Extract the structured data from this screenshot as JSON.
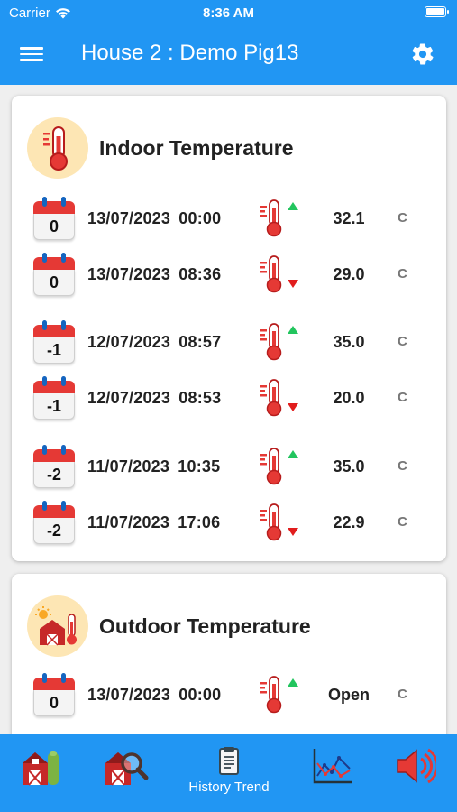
{
  "status_bar": {
    "carrier": "Carrier",
    "time": "8:36 AM"
  },
  "header": {
    "title": "House 2 : Demo Pig13"
  },
  "indoor": {
    "title": "Indoor Temperature",
    "rows": [
      {
        "day": "0",
        "datetime": "13/07/2023  00:00",
        "trend": "up",
        "value": "32.1",
        "unit": "C"
      },
      {
        "day": "0",
        "datetime": "13/07/2023  08:36",
        "trend": "down",
        "value": "29.0",
        "unit": "C"
      },
      {
        "day": "-1",
        "datetime": "12/07/2023  08:57",
        "trend": "up",
        "value": "35.0",
        "unit": "C"
      },
      {
        "day": "-1",
        "datetime": "12/07/2023  08:53",
        "trend": "down",
        "value": "20.0",
        "unit": "C"
      },
      {
        "day": "-2",
        "datetime": "11/07/2023  10:35",
        "trend": "up",
        "value": "35.0",
        "unit": "C"
      },
      {
        "day": "-2",
        "datetime": "11/07/2023  17:06",
        "trend": "down",
        "value": "22.9",
        "unit": "C"
      }
    ]
  },
  "outdoor": {
    "title": "Outdoor Temperature",
    "rows": [
      {
        "day": "0",
        "datetime": "13/07/2023  00:00",
        "trend": "up",
        "value": "Open",
        "unit": "C"
      }
    ]
  },
  "bottom_nav": [
    {
      "icon": "barn-icon",
      "label": ""
    },
    {
      "icon": "barn-search-icon",
      "label": ""
    },
    {
      "icon": "document-icon",
      "label": "History Trend"
    },
    {
      "icon": "line-chart-icon",
      "label": ""
    },
    {
      "icon": "speaker-icon",
      "label": ""
    }
  ],
  "colors": {
    "primary": "#2196F3",
    "up": "#22c55e",
    "down": "#e11d1d",
    "calendar_red": "#e53935"
  }
}
